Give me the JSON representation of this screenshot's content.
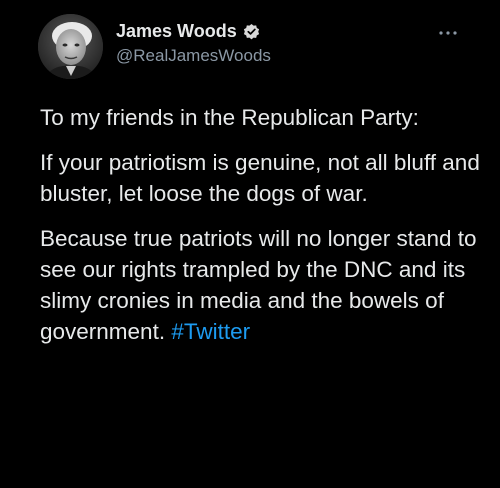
{
  "author": {
    "display_name": "James Woods",
    "handle": "@RealJamesWoods",
    "verified": true,
    "avatar": "profile-photo"
  },
  "icons": {
    "verified": "verified-badge-icon",
    "more": "more-options-icon"
  },
  "tweet": {
    "para1": "To my friends in the Republican Party:",
    "para2": "If your patriotism is genuine, not all bluff and bluster, let loose the dogs of war.",
    "para3": "Because true patriots will no longer stand to see our rights trampled by the DNC and its slimy cronies in media and the bowels of government.",
    "hashtag": "#Twitter"
  },
  "colors": {
    "background": "#000000",
    "text": "#e7e9ea",
    "secondary_text": "#8b98a5",
    "link": "#1d9bf0",
    "verified_badge": "#d9d9d9"
  }
}
